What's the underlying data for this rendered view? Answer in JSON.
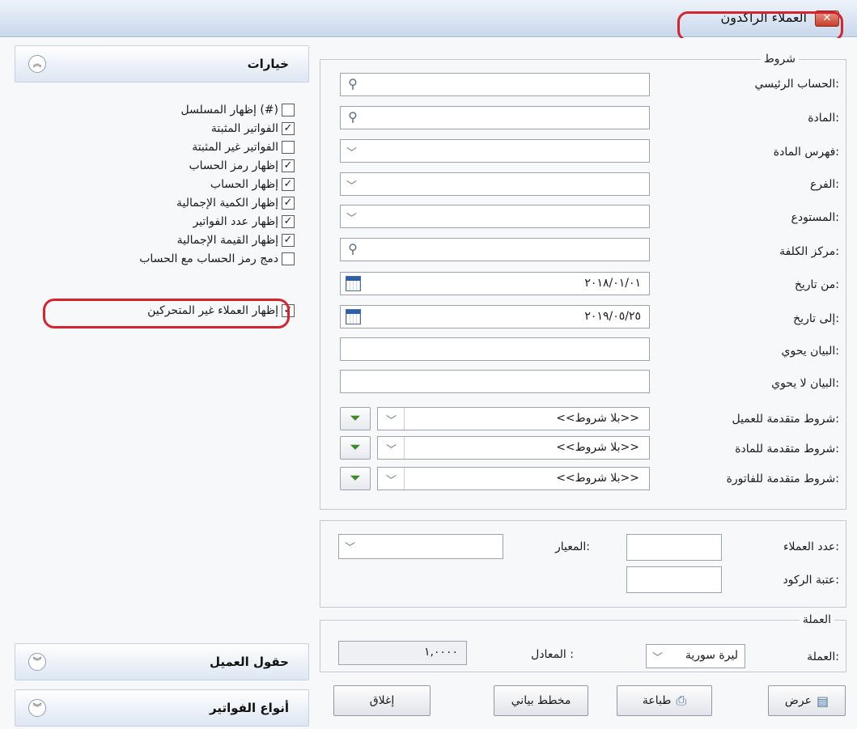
{
  "window": {
    "title": "العملاء الراكدون",
    "close_label": "✕"
  },
  "options_panel": {
    "title": "خيارات",
    "options": [
      {
        "label": "إظهار المسلسل (#)",
        "checked": false
      },
      {
        "label": "الفواتير المثبتة",
        "checked": true
      },
      {
        "label": "الفواتير غير المثبتة",
        "checked": false
      },
      {
        "label": "إظهار رمز الحساب",
        "checked": true
      },
      {
        "label": "إظهار الحساب",
        "checked": true
      },
      {
        "label": "إظهار الكمية الإجمالية",
        "checked": true
      },
      {
        "label": "إظهار عدد الفواتير",
        "checked": true
      },
      {
        "label": "إظهار القيمة الإجمالية",
        "checked": true
      },
      {
        "label": "دمج رمز الحساب مع الحساب",
        "checked": false
      },
      {
        "label": "إظهار العملاء غير المتحركين",
        "checked": true
      }
    ]
  },
  "customer_fields_panel": {
    "title": "حقول العميل"
  },
  "invoice_types_panel": {
    "title": "أنواع الفواتير"
  },
  "conditions": {
    "legend": "شروط",
    "main_account": {
      "label": "الحساب الرئيسي:",
      "value": ""
    },
    "material": {
      "label": "المادة:",
      "value": ""
    },
    "material_index": {
      "label": "فهرس المادة:",
      "value": ""
    },
    "branch": {
      "label": "الفرع:",
      "value": ""
    },
    "warehouse": {
      "label": "المستودع:",
      "value": ""
    },
    "cost_center": {
      "label": "مركز الكلفة:",
      "value": ""
    },
    "from_date": {
      "label": "من تاريخ:",
      "value": "٢٠١٨/٠١/٠١"
    },
    "to_date": {
      "label": "إلى تاريخ:",
      "value": "٢٠١٩/٠٥/٢٥"
    },
    "statement_contains": {
      "label": "البيان يحوي:",
      "value": ""
    },
    "statement_not_contains": {
      "label": "البيان لا يحوي:",
      "value": ""
    },
    "adv_customer": {
      "label": "شروط متقدمة للعميل:",
      "value": "<<بلا شروط>>"
    },
    "adv_material": {
      "label": "شروط متقدمة للمادة:",
      "value": "<<بلا شروط>>"
    },
    "adv_invoice": {
      "label": "شروط متقدمة للفاتورة:",
      "value": "<<بلا شروط>>"
    }
  },
  "stagnation": {
    "customer_count_label": "عدد العملاء:",
    "criterion_label": "المعيار:",
    "threshold_label": "عتبة الركود:"
  },
  "currency": {
    "legend": "العملة",
    "label": "العملة:",
    "value": "ليرة سورية",
    "equivalent_label": "المعادل :",
    "equivalent_value": "١,٠٠٠٠"
  },
  "buttons": {
    "view": "عرض",
    "print": "طباعة",
    "chart": "مخطط بياني",
    "close": "إغلاق"
  },
  "icons": {
    "search": "magnifier-icon",
    "calendar": "calendar-icon",
    "dropdown": "chevron-down-icon",
    "filter": "filter-icon",
    "expand": "double-chevron-icon"
  }
}
